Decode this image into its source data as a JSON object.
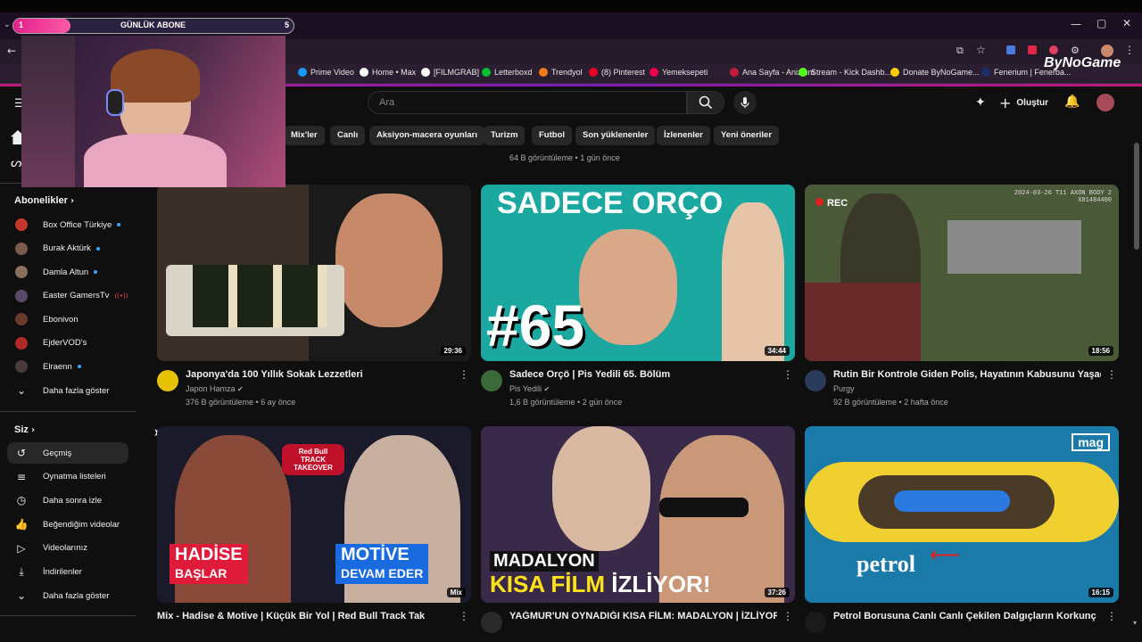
{
  "overlay": {
    "widget_left": "1",
    "widget_title": "GÜNLÜK ABONE",
    "widget_right": "5",
    "brand": "ByNoGame"
  },
  "bookmarks": [
    {
      "label": "Prime Video",
      "color": "#1a98ff"
    },
    {
      "label": "Home • Max",
      "color": "#ffffff"
    },
    {
      "label": "[FILMGRAB]",
      "color": "#ffffff"
    },
    {
      "label": "Letterboxd",
      "color": "#00c030"
    },
    {
      "label": "Trendyol",
      "color": "#f27a1a"
    },
    {
      "label": "(8) Pinterest",
      "color": "#e60023"
    },
    {
      "label": "Yemeksepeti",
      "color": "#ea004b"
    },
    {
      "label": "Ana Sayfa - Anizium",
      "color": "#c21b3a"
    },
    {
      "label": "Stream - Kick Dashb...",
      "color": "#53fc18"
    },
    {
      "label": "Donate ByNoGame...",
      "color": "#ffcc00"
    },
    {
      "label": "Fenerium | Fenerba...",
      "color": "#1c2d6b"
    }
  ],
  "header": {
    "search_placeholder": "Ara",
    "create_label": "Oluştur"
  },
  "chips": [
    "Mix'ler",
    "Canlı",
    "Aksiyon-macera oyunları",
    "Turizm",
    "Futbol",
    "Son yüklenenler",
    "İzlenenler",
    "Yeni öneriler"
  ],
  "partial_meta": "64 B görüntüleme • 1 gün önce",
  "sidebar": {
    "subs_header": "Abonelikler",
    "subs": [
      {
        "label": "Box Office Türkiye",
        "status": "dot",
        "color": "#c0392b"
      },
      {
        "label": "Burak Aktürk",
        "status": "dot",
        "color": "#7a5c4a"
      },
      {
        "label": "Damla Altun",
        "status": "dot",
        "color": "#8a6f5a"
      },
      {
        "label": "Easter GamersTv",
        "status": "live",
        "color": "#5a4a6a"
      },
      {
        "label": "Ebonivon",
        "status": "",
        "color": "#6a3a2a"
      },
      {
        "label": "EjderVOD's",
        "status": "",
        "color": "#b02a2a"
      },
      {
        "label": "Elraenn",
        "status": "dot",
        "color": "#4a3a3a"
      }
    ],
    "subs_more": "Daha fazla göster",
    "you_header": "Siz",
    "you_items": [
      {
        "label": "Geçmiş",
        "icon": "history-icon",
        "glyph": "↺"
      },
      {
        "label": "Oynatma listeleri",
        "icon": "playlists-icon",
        "glyph": "≡"
      },
      {
        "label": "Daha sonra izle",
        "icon": "clock-icon",
        "glyph": "◷"
      },
      {
        "label": "Beğendiğim videolar",
        "icon": "thumbs-up-icon",
        "glyph": "👍"
      },
      {
        "label": "Videolarınız",
        "icon": "play-box-icon",
        "glyph": "▷"
      },
      {
        "label": "İndirilenler",
        "icon": "download-icon",
        "glyph": "⤓"
      }
    ],
    "you_more": "Daha fazla göster"
  },
  "videos": [
    {
      "title": "Japonya'da 100 Yıllık Sokak Lezzetleri",
      "channel": "Japon Hamza",
      "verified": true,
      "meta": "376 B görüntüleme • 6 ay önce",
      "duration": "29:36",
      "thumb_bg": "#3a3028",
      "avatar": "#e6c200"
    },
    {
      "title": "Sadece Orçö | Pis Yedili 65. Bölüm",
      "channel": "Pis Yedili",
      "verified": true,
      "meta": "1,6 B görüntüleme • 2 gün önce",
      "duration": "34:44",
      "thumb_bg": "#1aa8a0",
      "avatar": "#3a6a3a",
      "thumb_text": "SADECE ORÇO",
      "thumb_big": "#65"
    },
    {
      "title": "Rutin Bir Kontrole Giden Polis, Hayatının Kabusunu Yaşadı",
      "channel": "Purgy",
      "verified": false,
      "meta": "92 B görüntüleme • 2 hafta önce",
      "duration": "18:56",
      "thumb_bg": "#4a5a38",
      "avatar": "#2a3a5a",
      "thumb_rec": "REC",
      "thumb_stamp": "2024-03-26 T11 AXON BODY 2 X81484400"
    },
    {
      "title": "Mix - Hadise & Motive | Küçük Bir Yol | Red Bull Track Takeover",
      "channel": "",
      "verified": false,
      "meta": "",
      "duration": "Mix",
      "thumb_bg": "#1a1a2a",
      "avatar": "",
      "thumb_left": "HADİSE",
      "thumb_left2": "BAŞLAR",
      "thumb_right": "MOTİVE",
      "thumb_right2": "DEVAM EDER",
      "thumb_logo": "Red Bull TRACK TAKEOVER"
    },
    {
      "title": "YAĞMUR'UN OYNADIĞI KISA FİLM: MADALYON | İZLİYOR!",
      "channel": "",
      "verified": false,
      "meta": "",
      "duration": "37:26",
      "thumb_bg": "#3a2a4a",
      "avatar": "#2a2a2a",
      "thumb_l1": "MADALYON",
      "thumb_l2a": "KISA FİLM",
      "thumb_l2b": "İZLİYOR!"
    },
    {
      "title": "Petrol Borusuna Canlı Canlı Çekilen Dalgıçların Korkunç",
      "channel": "",
      "verified": false,
      "meta": "",
      "duration": "16:15",
      "thumb_bg": "#1a7aa8",
      "avatar": "#1a1a1a",
      "thumb_word": "petrol",
      "thumb_badge": "mag"
    }
  ]
}
